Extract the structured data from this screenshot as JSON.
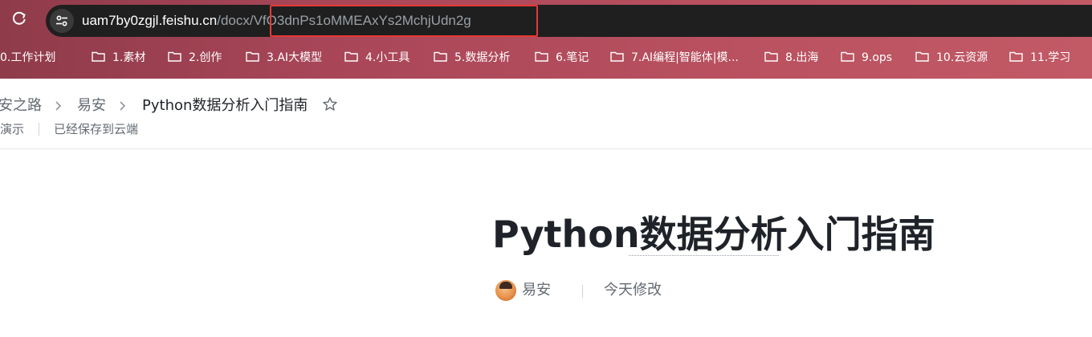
{
  "browser": {
    "url_host": "uam7by0zgjl.feishu.cn",
    "url_path_prefix": "/docx",
    "url_doc_id": "/VfO3dnPs1oMMEAxYs2MchjUdn2g",
    "reload_icon": "reload-icon",
    "site_info_icon": "tune-icon",
    "highlight_color": "#e53935"
  },
  "bookmarks": [
    {
      "label": "0.工作计划",
      "icon": "folder-icon"
    },
    {
      "label": "1.素材",
      "icon": "folder-icon"
    },
    {
      "label": "2.创作",
      "icon": "folder-icon"
    },
    {
      "label": "3.AI大模型",
      "icon": "folder-icon"
    },
    {
      "label": "4.小工具",
      "icon": "folder-icon"
    },
    {
      "label": "5.数据分析",
      "icon": "folder-icon"
    },
    {
      "label": "6.笔记",
      "icon": "folder-icon"
    },
    {
      "label": "7.AI编程|智能体|模...",
      "icon": "folder-icon"
    },
    {
      "label": "8.出海",
      "icon": "folder-icon"
    },
    {
      "label": "9.ops",
      "icon": "folder-icon"
    },
    {
      "label": "10.云资源",
      "icon": "folder-icon"
    },
    {
      "label": "11.学习",
      "icon": "folder-icon"
    }
  ],
  "breadcrumb": {
    "items": [
      "安之路",
      "易安",
      "Python数据分析入门指南"
    ],
    "star_icon": "star-outline-icon"
  },
  "subbar": {
    "present": "演示",
    "saved_status": "已经保存到云端"
  },
  "document": {
    "title": "Python数据分析入门指南",
    "author": "易安",
    "modified": "今天修改"
  }
}
